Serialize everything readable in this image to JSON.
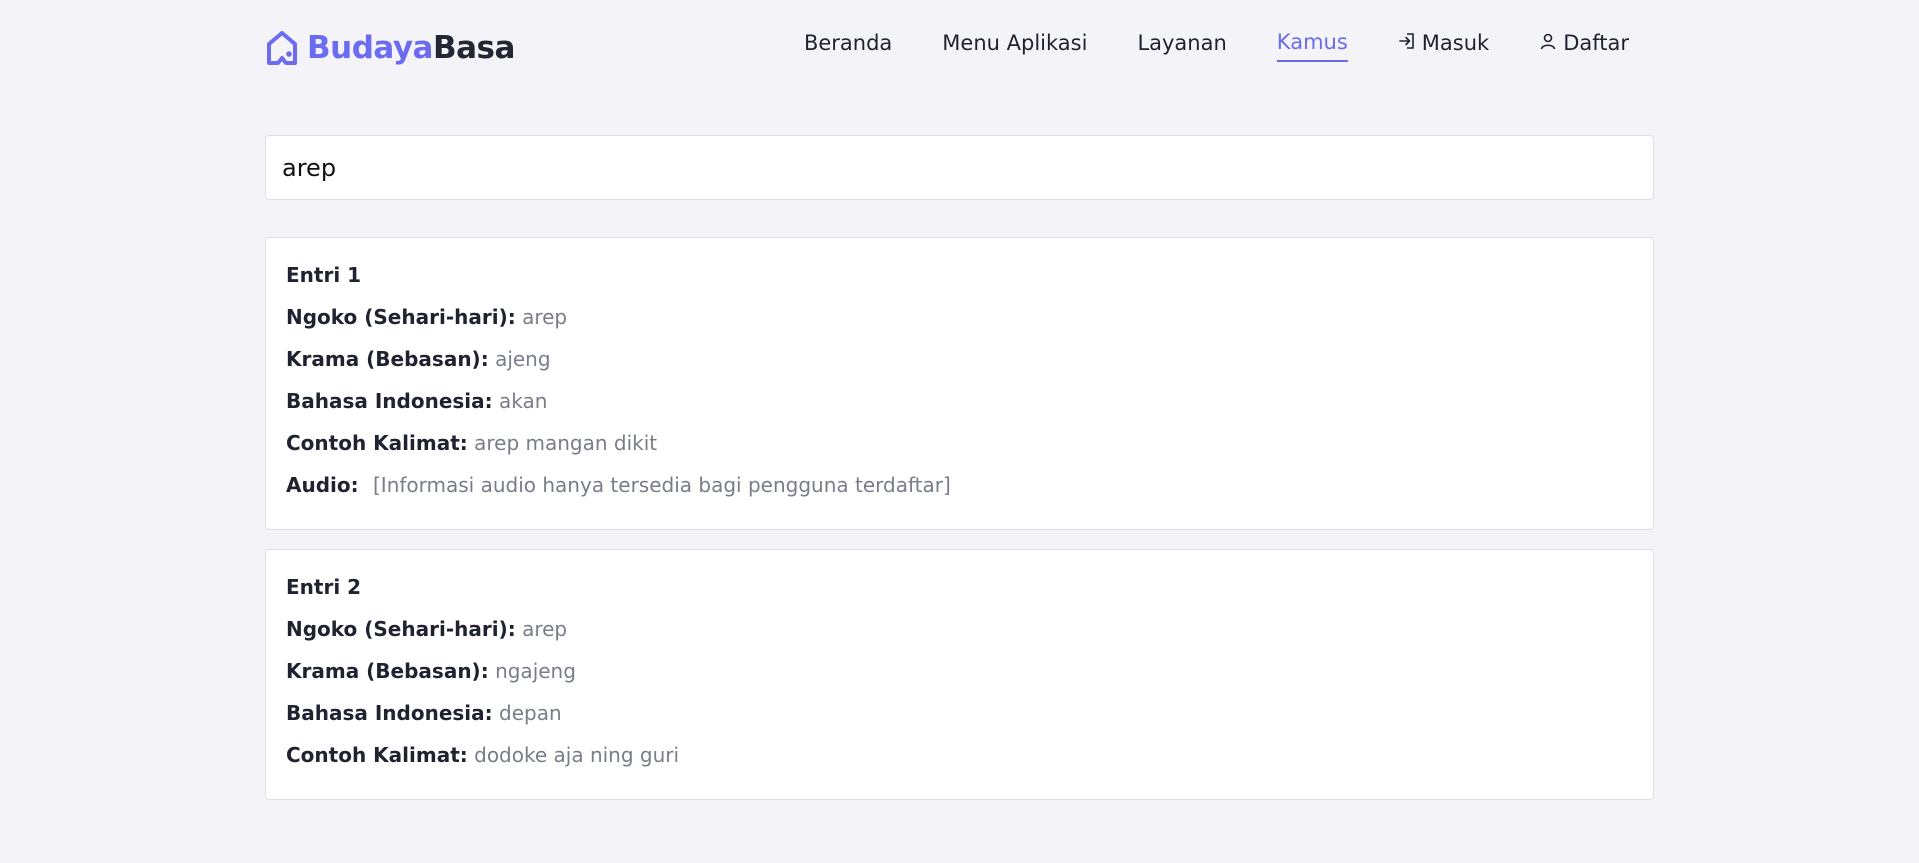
{
  "brand": {
    "part1": "Budaya",
    "part2": "Basa",
    "accent_color": "#6c6cf0",
    "icon": "house-icon"
  },
  "nav": {
    "items": [
      {
        "label": "Beranda",
        "active": false
      },
      {
        "label": "Menu Aplikasi",
        "active": false
      },
      {
        "label": "Layanan",
        "active": false
      },
      {
        "label": "Kamus",
        "active": true
      },
      {
        "label": "Masuk",
        "icon": "login-icon"
      },
      {
        "label": "Daftar",
        "icon": "user-icon"
      }
    ]
  },
  "search": {
    "value": "arep"
  },
  "entries": [
    {
      "title": "Entri 1",
      "ngoko_label": "Ngoko (Sehari-hari):",
      "ngoko": "arep",
      "krama_label": "Krama (Bebasan):",
      "krama": "ajeng",
      "indo_label": "Bahasa Indonesia:",
      "indo": "akan",
      "contoh_label": "Contoh Kalimat:",
      "contoh": "arep mangan dikit",
      "audio_label": "Audio:",
      "audio": "[Informasi audio hanya tersedia bagi pengguna terdaftar]"
    },
    {
      "title": "Entri 2",
      "ngoko_label": "Ngoko (Sehari-hari):",
      "ngoko": "arep",
      "krama_label": "Krama (Bebasan):",
      "krama": "ngajeng",
      "indo_label": "Bahasa Indonesia:",
      "indo": "depan",
      "contoh_label": "Contoh Kalimat:",
      "contoh": "dodoke aja ning guri"
    }
  ]
}
